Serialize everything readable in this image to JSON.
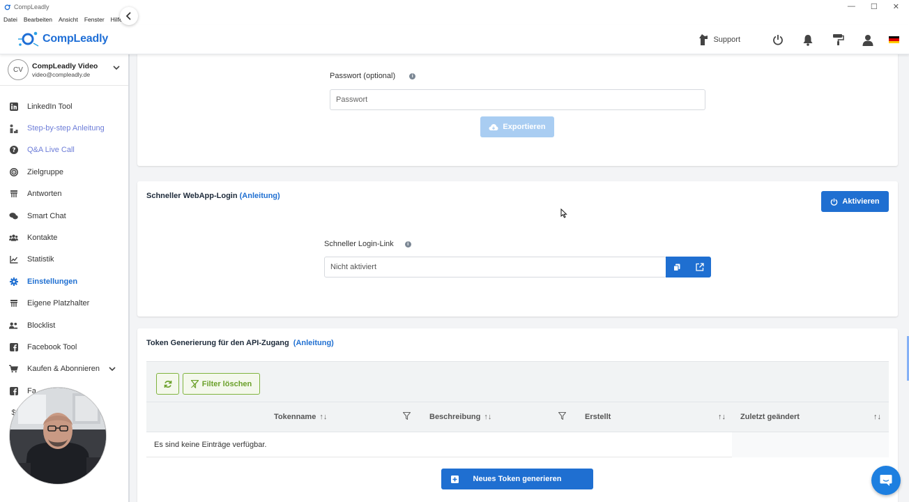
{
  "window": {
    "title": "CompLeadly",
    "controls": {
      "minimize": "—",
      "maximize": "☐",
      "close": "✕"
    }
  },
  "menu": [
    "Datei",
    "Bearbeiten",
    "Ansicht",
    "Fenster",
    "Hilfe"
  ],
  "header": {
    "brand": "CompLeadly",
    "support_label": "Support",
    "icons": [
      "support-icon",
      "power-icon",
      "bell-icon",
      "paint-roller-icon",
      "user-icon",
      "german-flag-icon"
    ]
  },
  "account": {
    "initials": "CV",
    "name": "CompLeadly Video",
    "email": "video@compleadly.de"
  },
  "sidebar": {
    "items": [
      {
        "label": "LinkedIn Tool",
        "icon": "linkedin-icon"
      },
      {
        "label": "Step-by-step Anleitung",
        "icon": "steps-icon"
      },
      {
        "label": "Q&A Live Call",
        "icon": "question-icon"
      },
      {
        "label": "Zielgruppe",
        "icon": "target-icon"
      },
      {
        "label": "Antworten",
        "icon": "reply-icon"
      },
      {
        "label": "Smart Chat",
        "icon": "chat-icon"
      },
      {
        "label": "Kontakte",
        "icon": "contacts-icon"
      },
      {
        "label": "Statistik",
        "icon": "chart-line-icon"
      },
      {
        "label": "Einstellungen",
        "icon": "gear-icon"
      },
      {
        "label": "Eigene Platzhalter",
        "icon": "placeholder-icon"
      },
      {
        "label": "Blocklist",
        "icon": "block-users-icon"
      },
      {
        "label": "Facebook Tool",
        "icon": "facebook-icon"
      },
      {
        "label": "Kaufen & Abonnieren",
        "icon": "cart-icon"
      },
      {
        "label": "Fa",
        "icon": "facebook-icon"
      },
      {
        "label": "$",
        "icon": "dollar-icon"
      }
    ]
  },
  "export_section": {
    "password_label": "Passwort (optional)",
    "password_placeholder": "Passwort",
    "export_button": "Exportieren"
  },
  "webapp_login": {
    "title": "Schneller WebApp-Login",
    "guide_link": "(Anleitung)",
    "activate_button": "Aktivieren",
    "link_label": "Schneller Login-Link",
    "link_value": "Nicht aktiviert"
  },
  "api_tokens": {
    "title": "Token Generierung für den API-Zugang",
    "guide_link": "(Anleitung)",
    "filter_clear_button": "Filter löschen",
    "columns": [
      "Tokenname",
      "Beschreibung",
      "Erstellt",
      "Zuletzt geändert"
    ],
    "sort_glyph": "↑↓",
    "empty_message": "Es sind keine Einträge verfügbar.",
    "new_token_button": "Neues Token generieren"
  },
  "colors": {
    "primary": "#1f6fd1",
    "export_disabled": "#a9cdf2",
    "filter_green": "#7fb33d"
  }
}
